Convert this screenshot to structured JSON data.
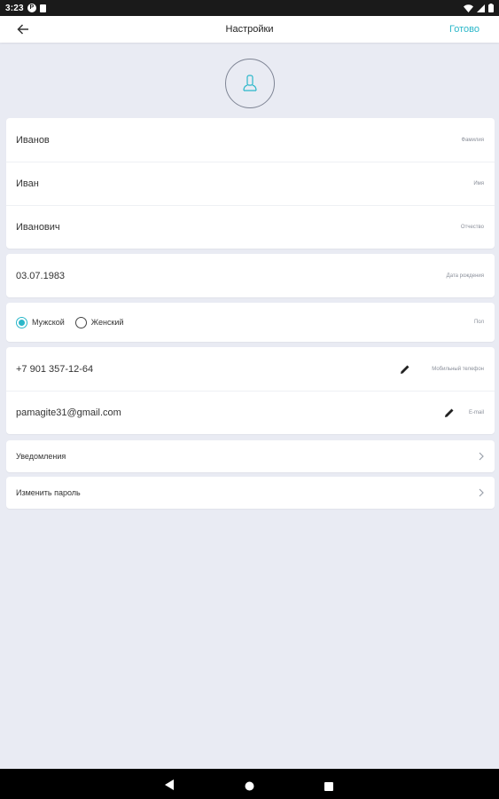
{
  "status_bar": {
    "time": "3:23",
    "icon_p": "P"
  },
  "app_bar": {
    "title": "Настройки",
    "done": "Готово"
  },
  "personal": {
    "last_name": {
      "value": "Иванов",
      "caption": "Фамилия"
    },
    "first_name": {
      "value": "Иван",
      "caption": "Имя"
    },
    "middle_name": {
      "value": "Иванович",
      "caption": "Отчество"
    }
  },
  "birth": {
    "value": "03.07.1983",
    "caption": "Дата рождения"
  },
  "gender": {
    "male": "Мужской",
    "female": "Женский",
    "caption": "Пол",
    "selected": "male"
  },
  "contacts": {
    "phone": {
      "value": "+7 901 357-12-64",
      "caption": "Мобильный телефон"
    },
    "email": {
      "value": "pamagite31@gmail.com",
      "caption": "E-mail"
    }
  },
  "links": {
    "notifications": "Уведомления",
    "change_password": "Изменить пароль"
  },
  "colors": {
    "accent": "#2ab7c9",
    "background": "#e9ebf3",
    "card": "#ffffff"
  }
}
